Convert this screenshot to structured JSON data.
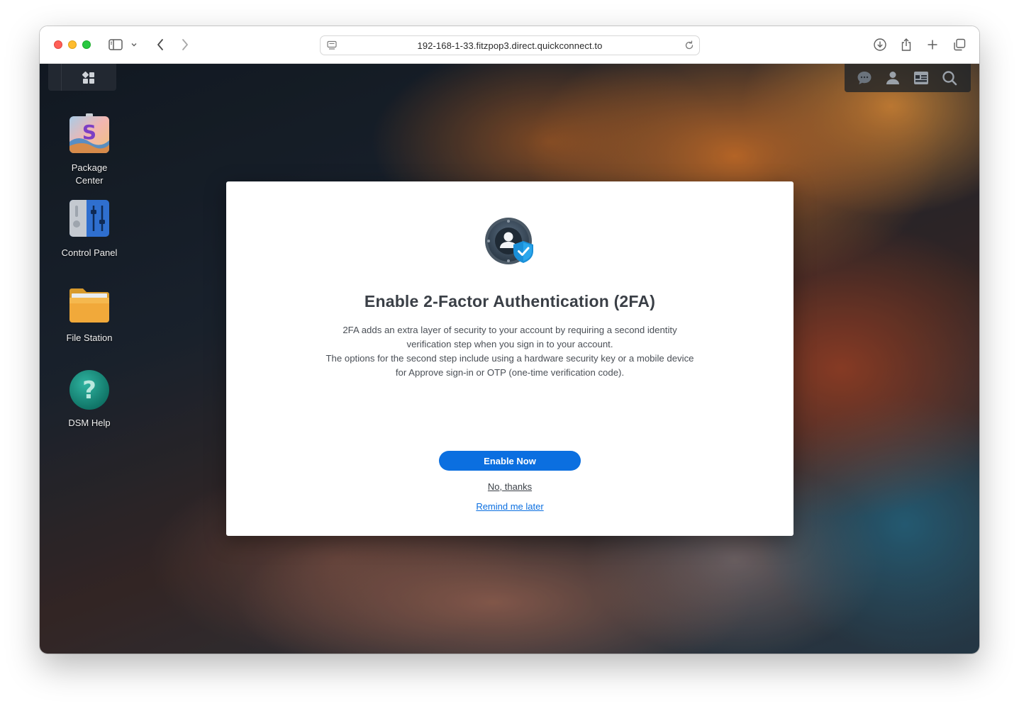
{
  "browser": {
    "url": "192-168-1-33.fitzpop3.direct.quickconnect.to",
    "icons": [
      "sidebar-icon",
      "chevron-down-icon",
      "back-icon",
      "forward-icon",
      "site-settings-icon",
      "reload-icon",
      "download-icon",
      "share-icon",
      "new-tab-icon",
      "tab-overview-icon"
    ]
  },
  "dsm": {
    "taskbar": {
      "icons": [
        "main-menu-grid-icon",
        "chat-icon",
        "user-icon",
        "widgets-icon",
        "search-icon"
      ]
    },
    "desktop_icons": [
      {
        "label_line1": "Package",
        "label_line2": "Center",
        "icon": "package-center-icon"
      },
      {
        "label": "Control Panel",
        "icon": "control-panel-icon"
      },
      {
        "label": "File Station",
        "icon": "folder-icon"
      },
      {
        "label": "DSM Help",
        "icon": "help-icon"
      }
    ]
  },
  "dialog": {
    "title": "Enable 2-Factor Authentication (2FA)",
    "desc_line1": "2FA adds an extra layer of security to your account by requiring a second identity",
    "desc_line2": "verification step when you sign in to your account.",
    "desc_line3": "The options for the second step include using a hardware security key or a mobile device",
    "desc_line4": "for Approve sign-in or OTP (one-time verification code).",
    "enable_label": "Enable Now",
    "no_thanks_label": "No, thanks",
    "remind_label": "Remind me later",
    "accent_color": "#0b6fe0"
  }
}
